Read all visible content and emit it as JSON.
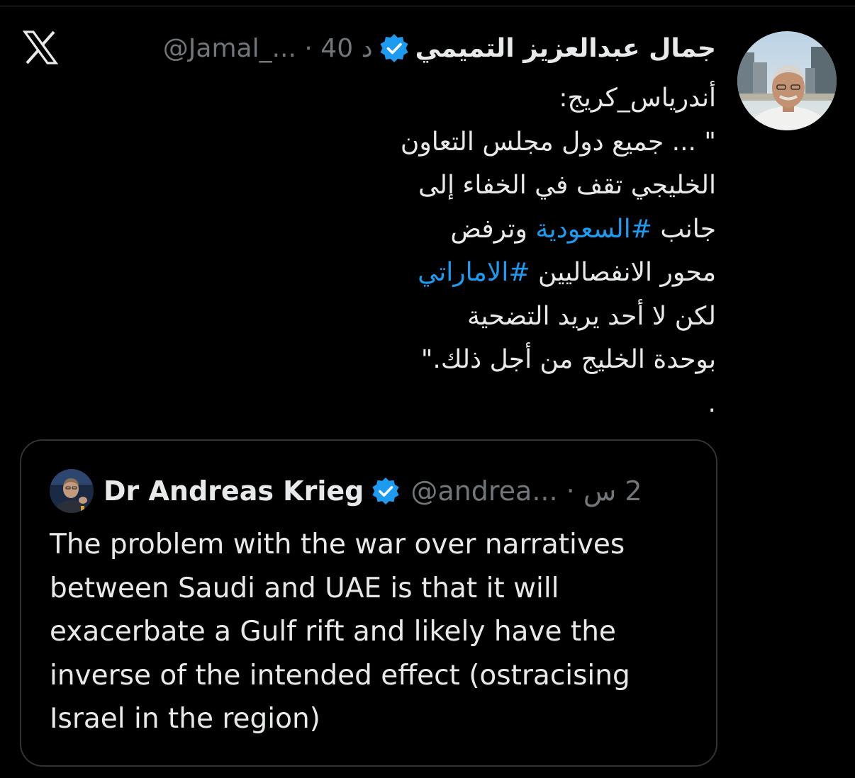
{
  "colors": {
    "background": "#000000",
    "text_primary": "#e7e9ea",
    "text_secondary": "#71767b",
    "link_blue": "#1d9bf0",
    "verified_blue": "#1d9bf0",
    "border": "#2f3336"
  },
  "icons": {
    "platform_logo": "x-logo-icon",
    "verified": "verified-badge-icon"
  },
  "tweet": {
    "author_name": "جمال عبدالعزيز التميمي",
    "handle": "@Jamal_...",
    "separator": "·",
    "time": "40 د",
    "lines": [
      "أندرياس_كريج:",
      "\" ... جميع دول مجلس التعاون",
      " الخليجي تقف في الخفاء إلى",
      "وترفض",
      "محور الانفصاليين",
      "لكن لا أحد يريد التضحية",
      "بوحدة الخليج من أجل ذلك.\"",
      "."
    ],
    "line4_prefix": "جانب",
    "hashtag_saudi": "#السعودية",
    "hashtag_emirati": "#الاماراتي"
  },
  "quote": {
    "author_name": "Dr Andreas Krieg",
    "handle": "@andrea...",
    "separator": "·",
    "time": "2 س",
    "lines": [
      "The problem with the war over narratives",
      "between Saudi and UAE is that it will",
      "exacerbate a Gulf rift and likely have the",
      "inverse of the intended effect (ostracising",
      "Israel in the region)"
    ]
  }
}
